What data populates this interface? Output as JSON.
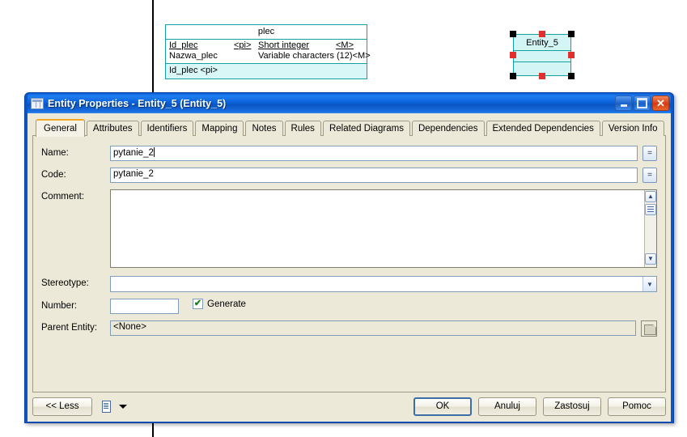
{
  "diagram": {
    "plec_entity": {
      "name": "plec",
      "attributes": [
        {
          "name": "Id_plec",
          "key": "<pi>",
          "type": "Short integer",
          "mandatory": "<M>",
          "primary": true
        },
        {
          "name": "Nazwa_plec",
          "key": "",
          "type": "Variable characters (12)",
          "mandatory": "<M>",
          "primary": false
        }
      ],
      "identifier": "Id_plec  <pi>",
      "border_color": "#14a0a0",
      "fill_color": "#d9f7f7"
    },
    "selected_entity": {
      "name": "Entity_5",
      "border_color": "#14a0a0",
      "fill_color": "#d4f5f5",
      "handle_color": "#000000",
      "handle_accent_color": "#e03030"
    }
  },
  "dialog": {
    "title": "Entity Properties - Entity_5 (Entity_5)",
    "title_icon": "table-icon",
    "accent_color": "#0a56c8",
    "window_buttons": {
      "minimize": "minimize-icon",
      "maximize": "maximize-icon",
      "close": "close-icon"
    },
    "tabs": [
      {
        "label": "General",
        "active": true
      },
      {
        "label": "Attributes",
        "active": false
      },
      {
        "label": "Identifiers",
        "active": false
      },
      {
        "label": "Mapping",
        "active": false
      },
      {
        "label": "Notes",
        "active": false
      },
      {
        "label": "Rules",
        "active": false
      },
      {
        "label": "Related Diagrams",
        "active": false
      },
      {
        "label": "Dependencies",
        "active": false
      },
      {
        "label": "Extended Dependencies",
        "active": false
      },
      {
        "label": "Version Info",
        "active": false
      }
    ],
    "active_tab_accent": "#f5a623",
    "form": {
      "name": {
        "label": "Name:",
        "value": "pytanie_2"
      },
      "code": {
        "label": "Code:",
        "value": "pytanie_2"
      },
      "equals_button_label": "=",
      "comment": {
        "label": "Comment:",
        "value": ""
      },
      "stereotype": {
        "label": "Stereotype:",
        "value": ""
      },
      "number": {
        "label": "Number:",
        "value": ""
      },
      "generate": {
        "label": "Generate",
        "checked": true,
        "check_glyph": "✔"
      },
      "parent_entity": {
        "label": "Parent Entity:",
        "value": "<None>"
      }
    },
    "scrollbar": {
      "up_glyph": "▲",
      "down_glyph": "▼",
      "editor_button": "text-editor-icon"
    },
    "footer": {
      "less_button": "<< Less",
      "print_icon": "report-icon",
      "dropdown_icon": "chevron-down-icon",
      "buttons": [
        {
          "label": "OK",
          "default": true
        },
        {
          "label": "Anuluj",
          "default": false
        },
        {
          "label": "Zastosuj",
          "default": false
        },
        {
          "label": "Pomoc",
          "default": false
        }
      ]
    }
  }
}
